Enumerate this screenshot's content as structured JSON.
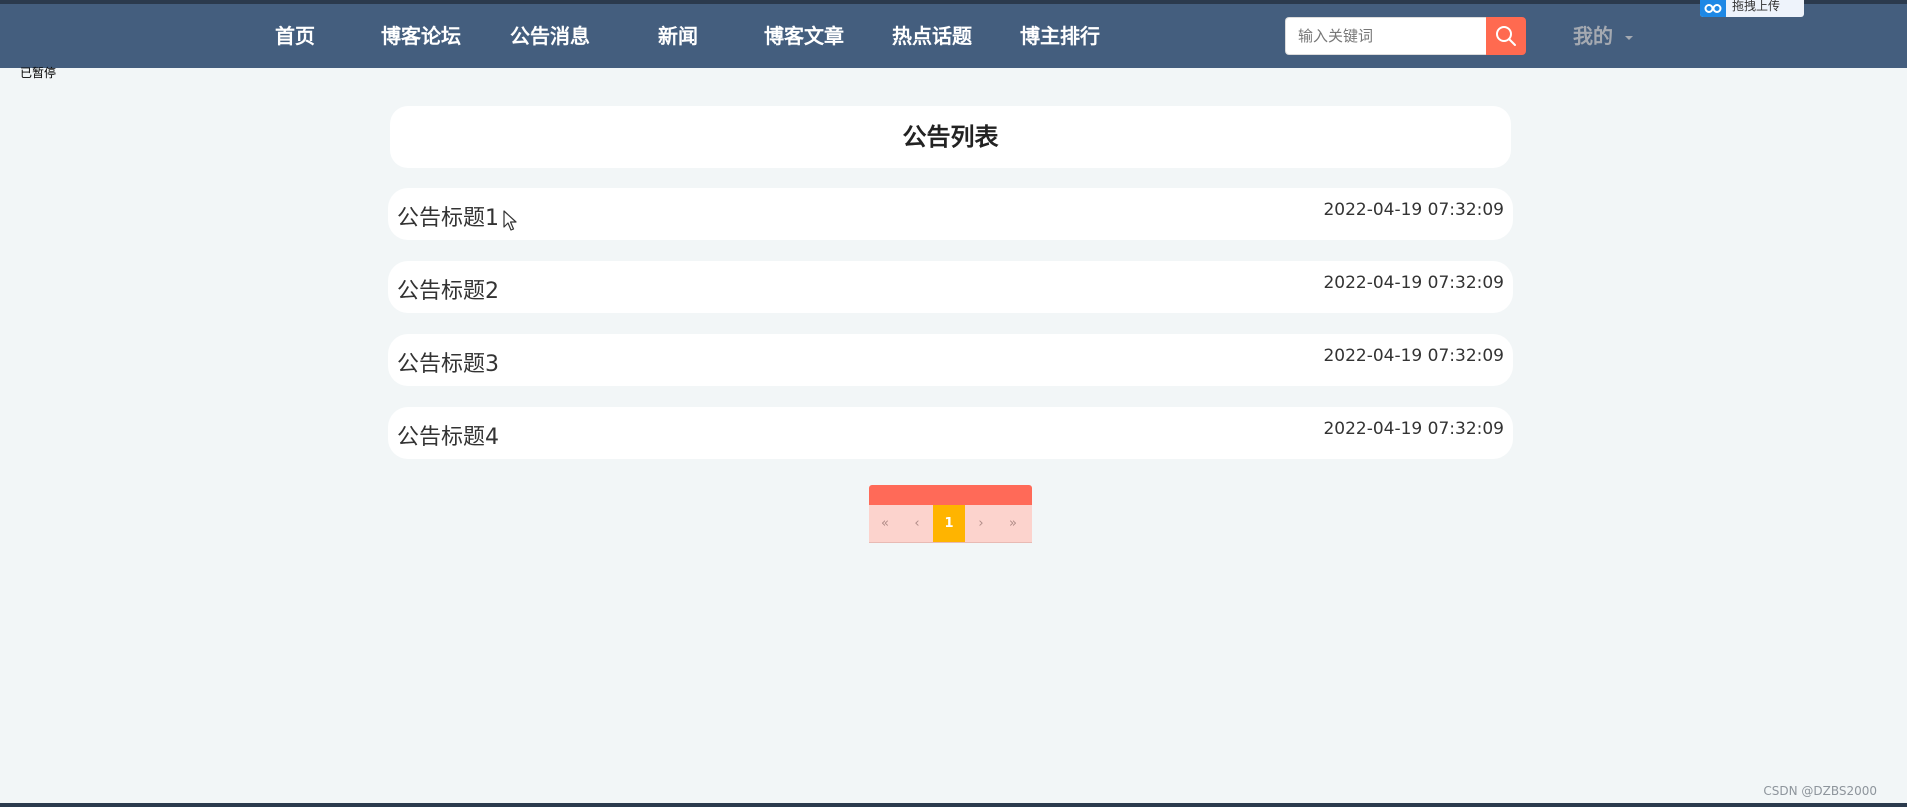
{
  "nav": {
    "items": [
      {
        "label": "首页"
      },
      {
        "label": "博客论坛"
      },
      {
        "label": "公告消息"
      },
      {
        "label": "新闻"
      },
      {
        "label": "博客文章"
      },
      {
        "label": "热点话题"
      },
      {
        "label": "博主排行"
      }
    ],
    "search_placeholder": "输入关键词",
    "search_icon": "search-icon",
    "mine_label": "我的"
  },
  "upload_widget": {
    "label": "拖拽上传"
  },
  "paused_label": "已暂停",
  "notice_list": {
    "title": "公告列表",
    "items": [
      {
        "title": "公告标题1",
        "time": "2022-04-19 07:32:09"
      },
      {
        "title": "公告标题2",
        "time": "2022-04-19 07:32:09"
      },
      {
        "title": "公告标题3",
        "time": "2022-04-19 07:32:09"
      },
      {
        "title": "公告标题4",
        "time": "2022-04-19 07:32:09"
      }
    ]
  },
  "pagination": {
    "first": "«",
    "prev": "‹",
    "current": "1",
    "next": "›",
    "last": "»"
  },
  "watermark": "CSDN @DZBS2000",
  "colors": {
    "navbar": "#445e7e",
    "accent": "#ff6a50",
    "page_bg": "#f2f6f7",
    "pager_active": "#ffb400"
  }
}
